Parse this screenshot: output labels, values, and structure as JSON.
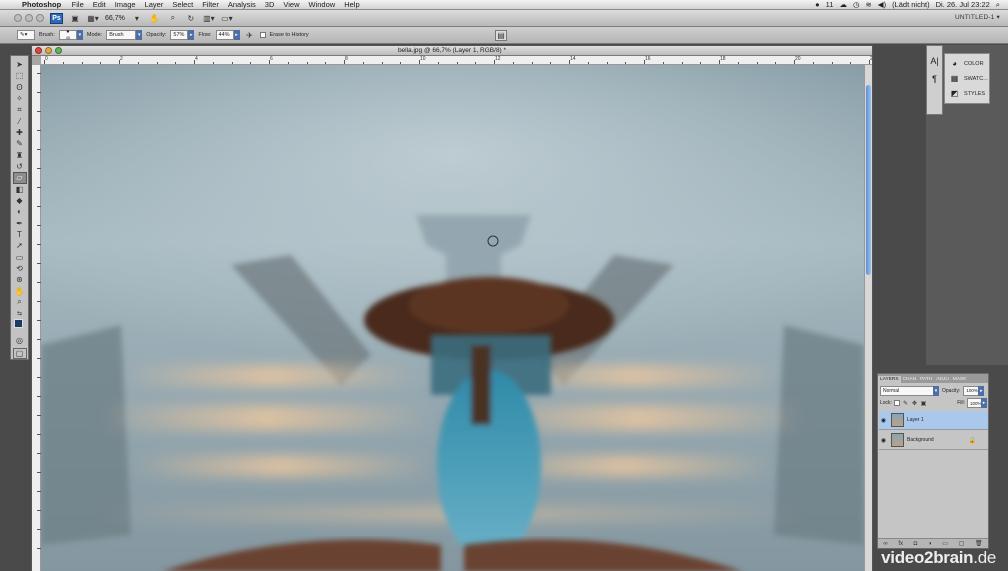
{
  "menubar": {
    "app_name": "Photoshop",
    "items": [
      "File",
      "Edit",
      "Image",
      "Layer",
      "Select",
      "Filter",
      "Analysis",
      "3D",
      "View",
      "Window",
      "Help"
    ],
    "status_left": "11",
    "clock_status": "(Lädt nicht)",
    "datetime": "Di. 26. Jul  23:22"
  },
  "appbar": {
    "app_badge": "Ps",
    "zoom": "66,7%"
  },
  "workspace": {
    "label": "UNTITLED-1"
  },
  "options": {
    "brush_label": "Brush:",
    "brush_size": "45",
    "mode_label": "Mode:",
    "mode_value": "Brush",
    "opacity_label": "Opacity:",
    "opacity_value": "57%",
    "flow_label": "Flow:",
    "flow_value": "44%",
    "erase_to_history": "Erase to History"
  },
  "document": {
    "title": "bella.jpg @ 66,7% (Layer 1, RGB/8) *"
  },
  "ruler": {
    "numbers": [
      "0",
      "2",
      "4",
      "6",
      "8",
      "10",
      "12",
      "14",
      "16",
      "18",
      "20",
      "22"
    ]
  },
  "dock": {
    "panels": [
      {
        "icon": "color-icon",
        "label": "COLOR"
      },
      {
        "icon": "swatches-icon",
        "label": "SWATC..."
      },
      {
        "icon": "styles-icon",
        "label": "STYLES"
      }
    ]
  },
  "layers": {
    "tabs": [
      "LAYERS",
      "CHAN",
      "PATH",
      "ADJU",
      "MASK"
    ],
    "blend_mode": "Normal",
    "opacity_label": "Opacity:",
    "opacity_value": "100%",
    "lock_label": "Lock:",
    "fill_label": "Fill:",
    "fill_value": "100%",
    "items": [
      {
        "name": "Layer 1",
        "selected": true
      },
      {
        "name": "Background",
        "selected": false
      }
    ]
  },
  "watermark": {
    "brand_bold": "video2brain",
    "brand_tld": ".de"
  }
}
